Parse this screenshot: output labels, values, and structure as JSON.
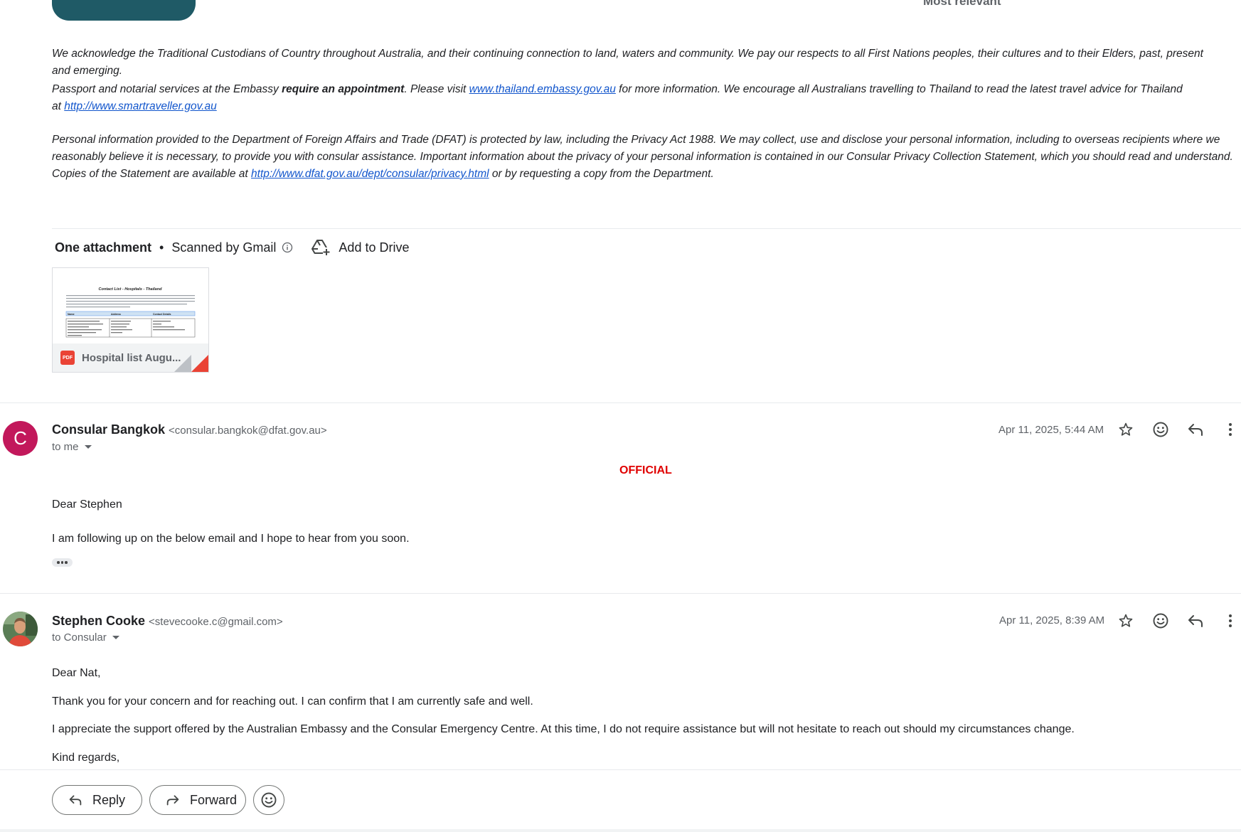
{
  "header": {
    "sort_label": "Most relevant"
  },
  "signature": {
    "acknowledgement": "We acknowledge the Traditional Custodians of Country throughout Australia, and their continuing connection to land, waters and community. We pay our respects to all First Nations peoples, their cultures and to their Elders, past, present and emerging.",
    "passport_prefix": "Passport and notarial services at the Embassy ",
    "passport_bold": "require an appointment",
    "passport_mid": ". Please visit  ",
    "passport_link": "www.thailand.embassy.gov.au",
    "passport_after": " for more information. We encourage all Australians travelling to Thailand to read the latest travel advice for Thailand at ",
    "travel_link": "http://www.smartraveller.gov.au",
    "privacy_text": "Personal information provided to the Department of Foreign Affairs and Trade (DFAT) is protected by law, including the Privacy Act 1988. We may collect, use and disclose your personal information, including to overseas recipients where we reasonably believe it is necessary, to provide you with consular assistance. Important information about the privacy of your personal information is contained in our Consular Privacy Collection Statement, which you should read and understand.  Copies of the Statement are available at ",
    "privacy_link": "http://www.dfat.gov.au/dept/consular/privacy.html",
    "privacy_after": " or by requesting a copy from the Department."
  },
  "attachments": {
    "title": "One attachment",
    "scanned": "Scanned by Gmail",
    "add_to_drive": "Add to Drive",
    "file": {
      "name": "Hospital list Augu...",
      "type_badge": "PDF",
      "preview_title": "Contact List - Hospitals - Thailand",
      "preview_cols": [
        "Name",
        "Address",
        "Contact Details"
      ]
    }
  },
  "messages": [
    {
      "avatar_letter": "C",
      "avatar_color": "#c2185b",
      "sender_name": "Consular Bangkok",
      "sender_email": "<consular.bangkok@dfat.gov.au>",
      "recipient": "to me",
      "date": "Apr 11, 2025, 5:44 AM",
      "classification": "OFFICIAL",
      "greeting": "Dear Stephen",
      "body": "I am following up on the below email and I hope to hear from you soon."
    },
    {
      "sender_name": "Stephen Cooke",
      "sender_email": "<stevecooke.c@gmail.com>",
      "recipient": "to Consular",
      "date": "Apr 11, 2025, 8:39 AM",
      "greeting": "Dear Nat,",
      "body1": "Thank you for your concern and for reaching out. I can confirm that I am currently safe and well.",
      "body2": "I appreciate the support offered by the Australian Embassy and the Consular Emergency Centre. At this time, I do not require assistance but will not hesitate to reach out should my circumstances change.",
      "closing": "Kind regards,"
    }
  ],
  "actions": {
    "reply": "Reply",
    "forward": "Forward"
  },
  "colors": {
    "accent": "#1f5a66",
    "link": "#1155cc",
    "official": "#e00000",
    "pdf": "#ea4335"
  }
}
